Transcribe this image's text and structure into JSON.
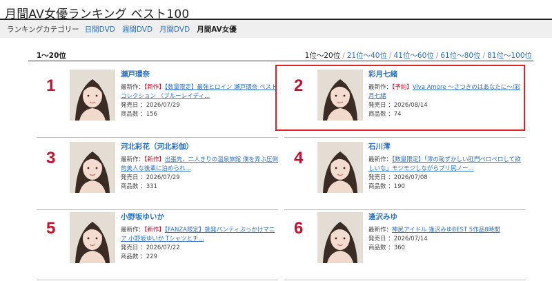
{
  "title": "月間AV女優ランキング ベスト100",
  "category_nav": {
    "label": "ランキングカテゴリー",
    "items": [
      "日間DVD",
      "週間DVD",
      "月間DVD",
      "月間AV女優"
    ],
    "active_index": 3
  },
  "range": {
    "current": "1〜20位",
    "pages": [
      "1位〜20位",
      "21位〜40位",
      "41位〜60位",
      "61位〜80位",
      "81位〜100位"
    ],
    "active_index": 0
  },
  "labels": {
    "latest": "最新作：",
    "release": "発売日 ：",
    "count": "商品数 ："
  },
  "ranking": [
    {
      "rank": "1",
      "name": "瀬戸環奈",
      "tag1": "【新作】",
      "tag2": "【数量限定】",
      "title": "最強ヒロイン 瀬戸環奈 ベストコレクション 〈ブルーレイディ...",
      "release": "2026/07/29",
      "count": "156",
      "highlight": false
    },
    {
      "rank": "2",
      "name": "彩月七緒",
      "tag1": "【予約】",
      "tag2": "",
      "title": "Viva Amore 〜さつきのはあなたに〜/彩月七緒",
      "release": "2026/08/14",
      "count": "74",
      "highlight": true
    },
    {
      "rank": "3",
      "name": "河北彩花（河北彩伽）",
      "tag1": "【新作】",
      "tag2": "",
      "title": "出張先、二人きりの温泉旅館 僕を弄ぶ圧倒的美人な後輩に泊められ...",
      "release": "2026/07/29",
      "count": "331",
      "highlight": false
    },
    {
      "rank": "4",
      "name": "石川澪",
      "tag1": "",
      "tag2": "【数量限定】",
      "title": "「澪の恥ずかしい肛門ペロペロして欲しいな」モジモジしながらプリ尻ノー...",
      "release": "2026/07/08",
      "count": "190",
      "highlight": false
    },
    {
      "rank": "5",
      "name": "小野坂ゆいか",
      "tag1": "【新作】",
      "tag2": "【FANZA限定】",
      "title": "挑発パンティぶっかけマニア 小野坂ゆいか Tシャツとチ...",
      "release": "2026/07/22",
      "count": "229",
      "highlight": false
    },
    {
      "rank": "6",
      "name": "逢沢みゆ",
      "tag1": "",
      "tag2": "",
      "title": "神尻アイドル 逢沢みゆBEST 5作品8時間",
      "release": "2026/07/14",
      "count": "360",
      "highlight": false
    }
  ],
  "colors": {
    "link": "#2a6fc2",
    "rank": "#c8102e",
    "tag_new": "#d0021b",
    "highlight_border": "#e02020",
    "nav_bg": "#efefef"
  }
}
